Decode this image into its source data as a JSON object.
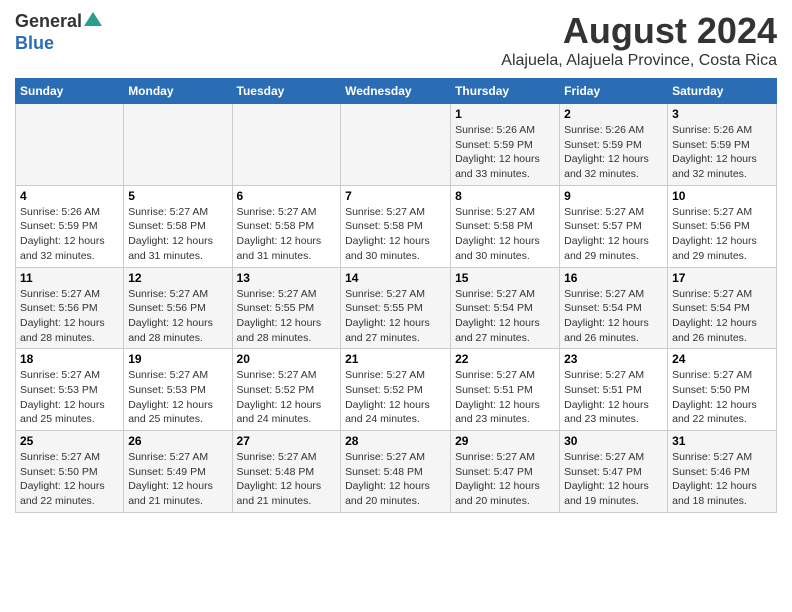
{
  "logo": {
    "general": "General",
    "blue": "Blue"
  },
  "title": {
    "month_year": "August 2024",
    "location": "Alajuela, Alajuela Province, Costa Rica"
  },
  "header": {
    "days": [
      "Sunday",
      "Monday",
      "Tuesday",
      "Wednesday",
      "Thursday",
      "Friday",
      "Saturday"
    ]
  },
  "weeks": [
    {
      "days": [
        {
          "num": "",
          "info": ""
        },
        {
          "num": "",
          "info": ""
        },
        {
          "num": "",
          "info": ""
        },
        {
          "num": "",
          "info": ""
        },
        {
          "num": "1",
          "info": "Sunrise: 5:26 AM\nSunset: 5:59 PM\nDaylight: 12 hours\nand 33 minutes."
        },
        {
          "num": "2",
          "info": "Sunrise: 5:26 AM\nSunset: 5:59 PM\nDaylight: 12 hours\nand 32 minutes."
        },
        {
          "num": "3",
          "info": "Sunrise: 5:26 AM\nSunset: 5:59 PM\nDaylight: 12 hours\nand 32 minutes."
        }
      ]
    },
    {
      "days": [
        {
          "num": "4",
          "info": "Sunrise: 5:26 AM\nSunset: 5:59 PM\nDaylight: 12 hours\nand 32 minutes."
        },
        {
          "num": "5",
          "info": "Sunrise: 5:27 AM\nSunset: 5:58 PM\nDaylight: 12 hours\nand 31 minutes."
        },
        {
          "num": "6",
          "info": "Sunrise: 5:27 AM\nSunset: 5:58 PM\nDaylight: 12 hours\nand 31 minutes."
        },
        {
          "num": "7",
          "info": "Sunrise: 5:27 AM\nSunset: 5:58 PM\nDaylight: 12 hours\nand 30 minutes."
        },
        {
          "num": "8",
          "info": "Sunrise: 5:27 AM\nSunset: 5:58 PM\nDaylight: 12 hours\nand 30 minutes."
        },
        {
          "num": "9",
          "info": "Sunrise: 5:27 AM\nSunset: 5:57 PM\nDaylight: 12 hours\nand 29 minutes."
        },
        {
          "num": "10",
          "info": "Sunrise: 5:27 AM\nSunset: 5:56 PM\nDaylight: 12 hours\nand 29 minutes."
        }
      ]
    },
    {
      "days": [
        {
          "num": "11",
          "info": "Sunrise: 5:27 AM\nSunset: 5:56 PM\nDaylight: 12 hours\nand 28 minutes."
        },
        {
          "num": "12",
          "info": "Sunrise: 5:27 AM\nSunset: 5:56 PM\nDaylight: 12 hours\nand 28 minutes."
        },
        {
          "num": "13",
          "info": "Sunrise: 5:27 AM\nSunset: 5:55 PM\nDaylight: 12 hours\nand 28 minutes."
        },
        {
          "num": "14",
          "info": "Sunrise: 5:27 AM\nSunset: 5:55 PM\nDaylight: 12 hours\nand 27 minutes."
        },
        {
          "num": "15",
          "info": "Sunrise: 5:27 AM\nSunset: 5:54 PM\nDaylight: 12 hours\nand 27 minutes."
        },
        {
          "num": "16",
          "info": "Sunrise: 5:27 AM\nSunset: 5:54 PM\nDaylight: 12 hours\nand 26 minutes."
        },
        {
          "num": "17",
          "info": "Sunrise: 5:27 AM\nSunset: 5:54 PM\nDaylight: 12 hours\nand 26 minutes."
        }
      ]
    },
    {
      "days": [
        {
          "num": "18",
          "info": "Sunrise: 5:27 AM\nSunset: 5:53 PM\nDaylight: 12 hours\nand 25 minutes."
        },
        {
          "num": "19",
          "info": "Sunrise: 5:27 AM\nSunset: 5:53 PM\nDaylight: 12 hours\nand 25 minutes."
        },
        {
          "num": "20",
          "info": "Sunrise: 5:27 AM\nSunset: 5:52 PM\nDaylight: 12 hours\nand 24 minutes."
        },
        {
          "num": "21",
          "info": "Sunrise: 5:27 AM\nSunset: 5:52 PM\nDaylight: 12 hours\nand 24 minutes."
        },
        {
          "num": "22",
          "info": "Sunrise: 5:27 AM\nSunset: 5:51 PM\nDaylight: 12 hours\nand 23 minutes."
        },
        {
          "num": "23",
          "info": "Sunrise: 5:27 AM\nSunset: 5:51 PM\nDaylight: 12 hours\nand 23 minutes."
        },
        {
          "num": "24",
          "info": "Sunrise: 5:27 AM\nSunset: 5:50 PM\nDaylight: 12 hours\nand 22 minutes."
        }
      ]
    },
    {
      "days": [
        {
          "num": "25",
          "info": "Sunrise: 5:27 AM\nSunset: 5:50 PM\nDaylight: 12 hours\nand 22 minutes."
        },
        {
          "num": "26",
          "info": "Sunrise: 5:27 AM\nSunset: 5:49 PM\nDaylight: 12 hours\nand 21 minutes."
        },
        {
          "num": "27",
          "info": "Sunrise: 5:27 AM\nSunset: 5:48 PM\nDaylight: 12 hours\nand 21 minutes."
        },
        {
          "num": "28",
          "info": "Sunrise: 5:27 AM\nSunset: 5:48 PM\nDaylight: 12 hours\nand 20 minutes."
        },
        {
          "num": "29",
          "info": "Sunrise: 5:27 AM\nSunset: 5:47 PM\nDaylight: 12 hours\nand 20 minutes."
        },
        {
          "num": "30",
          "info": "Sunrise: 5:27 AM\nSunset: 5:47 PM\nDaylight: 12 hours\nand 19 minutes."
        },
        {
          "num": "31",
          "info": "Sunrise: 5:27 AM\nSunset: 5:46 PM\nDaylight: 12 hours\nand 18 minutes."
        }
      ]
    }
  ]
}
